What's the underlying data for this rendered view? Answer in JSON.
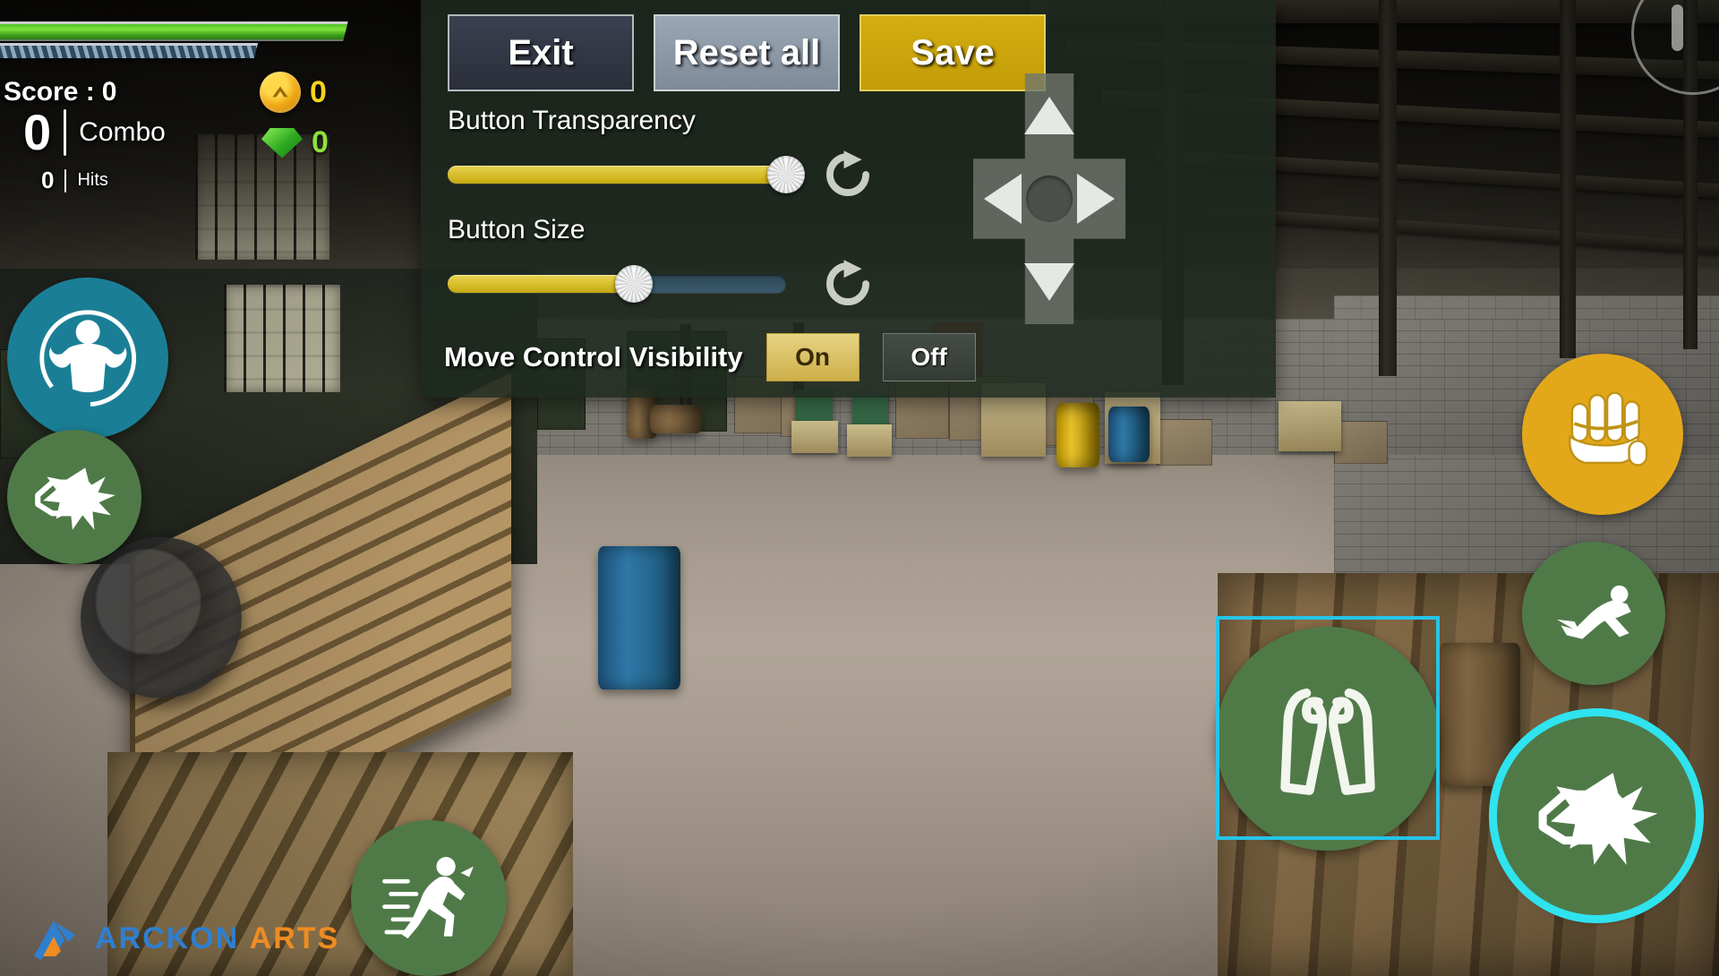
{
  "hud": {
    "score_label": "Score :",
    "score_value": "0",
    "combo_value": "0",
    "combo_label": "Combo",
    "hits_value": "0",
    "hits_label": "Hits",
    "coin_value": "0",
    "gem_value": "0",
    "health_percent": 100,
    "stamina_percent": 100,
    "health_color": "#5ecf2b",
    "stamina_color": "#2f4a5e"
  },
  "pause": {
    "name": "pause-button"
  },
  "settings": {
    "buttons": {
      "exit": "Exit",
      "reset_all": "Reset all",
      "save": "Save"
    },
    "colors": {
      "panel_bg": "#1e291f",
      "exit_bg": "#2b2f3a",
      "reset_bg": "#8e9aa7",
      "save_bg": "#c9a20d",
      "slider_fill": "#d7bd2a",
      "slider_track": "#35536a",
      "toggle_on_bg": "#cdb04a",
      "toggle_off_bg": "#3a403a",
      "selection": "#26c4e8"
    },
    "transparency": {
      "label": "Button Transparency",
      "value": 100,
      "reset_icon": "refresh-icon"
    },
    "size": {
      "label": "Button Size",
      "value": 55,
      "reset_icon": "refresh-icon"
    },
    "visibility": {
      "label": "Move Control Visibility",
      "on_label": "On",
      "off_label": "Off",
      "selected": "On"
    }
  },
  "dpad": {
    "up": "dpad-up-arrow",
    "down": "dpad-down-arrow",
    "left": "dpad-left-arrow",
    "right": "dpad-right-arrow"
  },
  "action_buttons": [
    {
      "name": "flex-muscle-button",
      "icon": "flexing-muscles-icon",
      "color": "#1a7f96",
      "selected": false,
      "highlighted": false
    },
    {
      "name": "punch-button-left",
      "icon": "punch-impact-icon",
      "color": "#4f7a48",
      "selected": false,
      "highlighted": false
    },
    {
      "name": "run-button",
      "icon": "running-man-icon",
      "color": "#4f7a48",
      "selected": false,
      "highlighted": false
    },
    {
      "name": "grab-button",
      "icon": "grabbing-hand-icon",
      "color": "#e3a81a",
      "selected": false,
      "highlighted": false
    },
    {
      "name": "dive-button",
      "icon": "diving-man-icon",
      "color": "#4f7a48",
      "selected": false,
      "highlighted": false
    },
    {
      "name": "block-button",
      "icon": "guard-arms-icon",
      "color": "#4f7a48",
      "selected": true,
      "highlighted": false
    },
    {
      "name": "punch-button-right",
      "icon": "punch-impact-icon",
      "color": "#4f7a48",
      "selected": false,
      "highlighted": true
    }
  ],
  "logo": {
    "first": "ARCKON",
    "second": "ARTS",
    "first_color": "#2f7fd0",
    "second_color": "#ef8c22"
  }
}
